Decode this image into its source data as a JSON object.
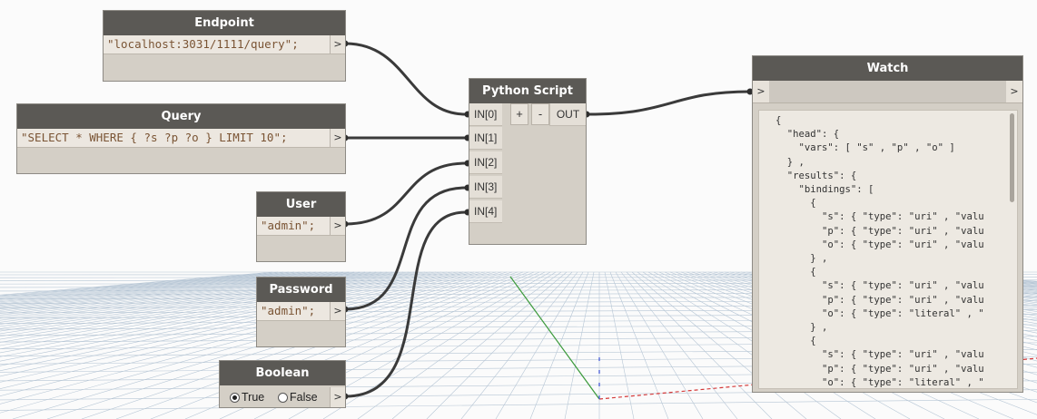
{
  "nodes": {
    "endpoint": {
      "title": "Endpoint",
      "value": "\"localhost:3031/1111/query\";",
      "out_port": ">"
    },
    "query": {
      "title": "Query",
      "value": "\"SELECT * WHERE { ?s ?p ?o } LIMIT 10\";",
      "out_port": ">"
    },
    "user": {
      "title": "User",
      "value": "\"admin\";",
      "out_port": ">"
    },
    "password": {
      "title": "Password",
      "value": "\"admin\";",
      "out_port": ">"
    },
    "boolean": {
      "title": "Boolean",
      "true_label": "True",
      "false_label": "False",
      "selected": "True",
      "out_port": ">"
    },
    "python": {
      "title": "Python Script",
      "inputs": [
        "IN[0]",
        "IN[1]",
        "IN[2]",
        "IN[3]",
        "IN[4]"
      ],
      "add_label": "+",
      "remove_label": "-",
      "output": "OUT"
    },
    "watch": {
      "title": "Watch",
      "in_port": ">",
      "out_port": ">",
      "content": "{\n  \"head\": {\n    \"vars\": [ \"s\" , \"p\" , \"o\" ]\n  } ,\n  \"results\": {\n    \"bindings\": [\n      {\n        \"s\": { \"type\": \"uri\" , \"valu\n        \"p\": { \"type\": \"uri\" , \"valu\n        \"o\": { \"type\": \"uri\" , \"valu\n      } ,\n      {\n        \"s\": { \"type\": \"uri\" , \"valu\n        \"p\": { \"type\": \"uri\" , \"valu\n        \"o\": { \"type\": \"literal\" , \"\n      } ,\n      {\n        \"s\": { \"type\": \"uri\" , \"valu\n        \"p\": { \"type\": \"uri\" , \"valu\n        \"o\": { \"type\": \"literal\" , \"\n      }"
    }
  },
  "colors": {
    "header": "#5b5955",
    "node_body": "#d4cfc6",
    "wire": "#3a3a3a",
    "string_literal": "#7a5434",
    "grid": "#9fb4c8"
  }
}
